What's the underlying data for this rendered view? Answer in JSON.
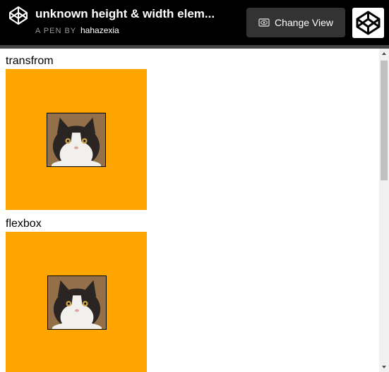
{
  "header": {
    "title": "unknown height & width elem...",
    "by_label": "A PEN BY",
    "author": "hahazexia",
    "change_view_label": "Change View",
    "logo_icon": "codepen-logo-icon",
    "view_icon": "eye-icon"
  },
  "sections": [
    {
      "label": "transfrom"
    },
    {
      "label": "flexbox"
    }
  ],
  "colors": {
    "header_bg": "#000000",
    "button_bg": "#333333",
    "box": "#ffa500"
  }
}
